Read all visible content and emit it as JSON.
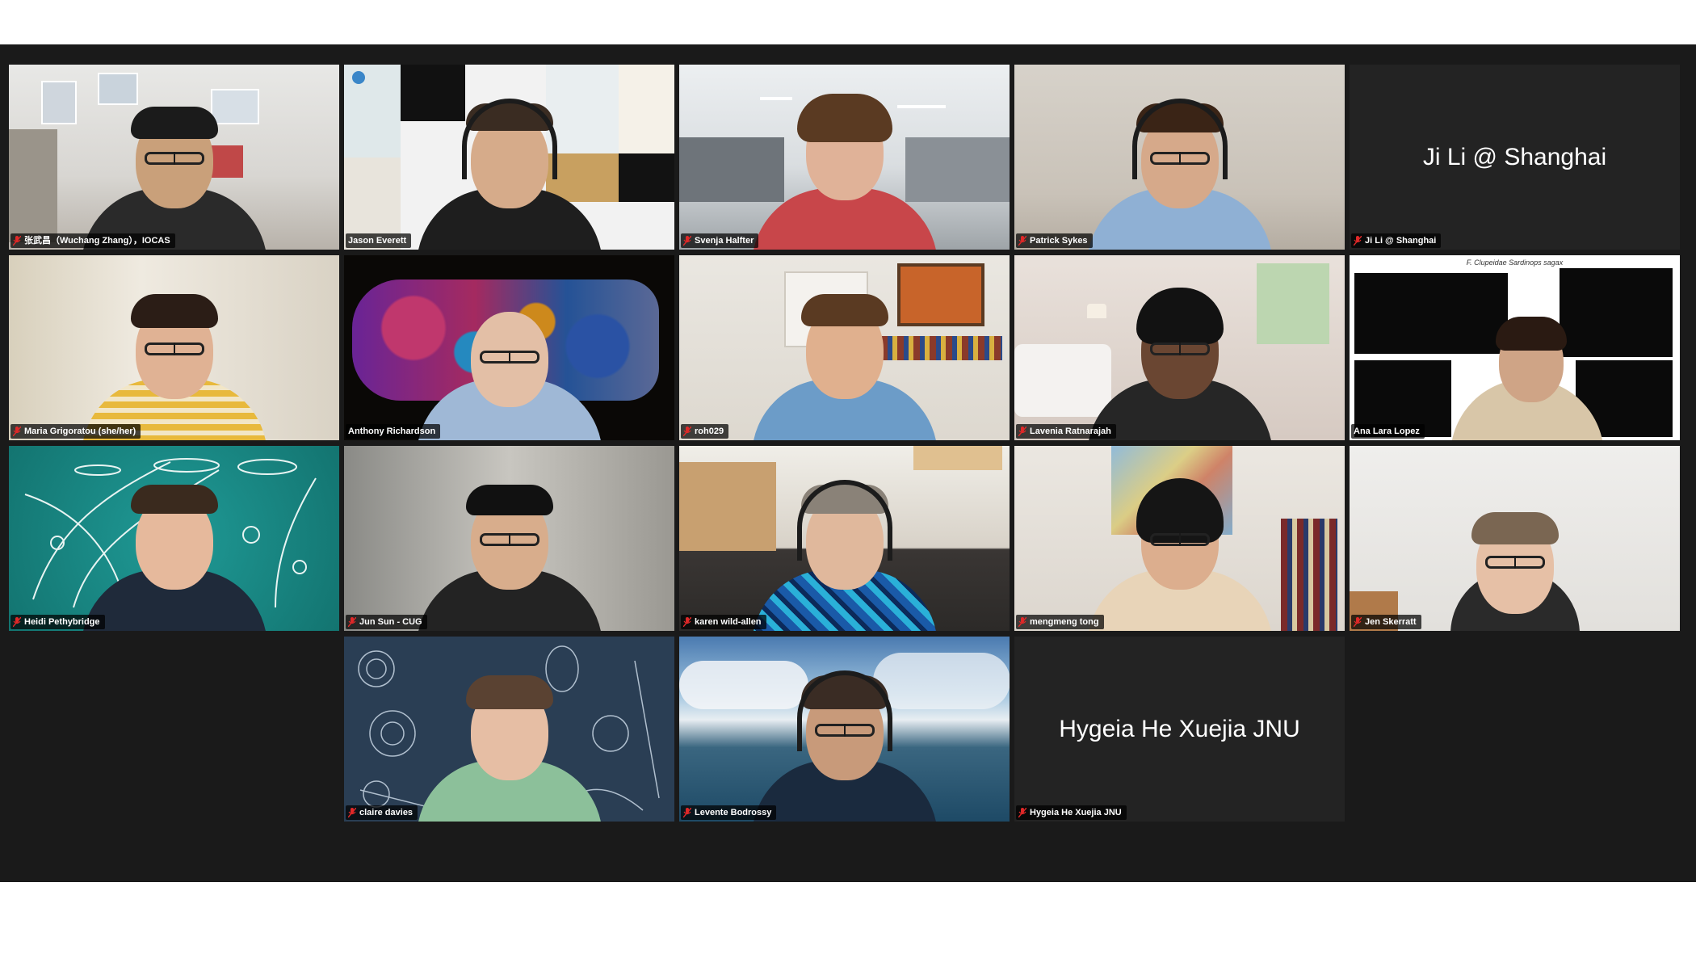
{
  "meeting": {
    "view": "gallery",
    "colors": {
      "background": "#1a1a1a",
      "tile_empty": "#232323",
      "active_speaker_border": "#c7e86a",
      "muted_icon": "#e02828",
      "name_text": "#ffffff"
    }
  },
  "participants": [
    {
      "name": "张武昌（Wuchang Zhang），IOCAS",
      "muted": true,
      "video": true
    },
    {
      "name": "Jason Everett",
      "muted": false,
      "video": true
    },
    {
      "name": "Svenja Halfter",
      "muted": true,
      "video": true
    },
    {
      "name": "Patrick Sykes",
      "muted": true,
      "video": true
    },
    {
      "name": "Ji Li @ Shanghai",
      "muted": true,
      "video": false,
      "display_name": "Ji Li @ Shanghai"
    },
    {
      "name": "Maria Grigoratou (she/her)",
      "muted": true,
      "video": true
    },
    {
      "name": "Anthony Richardson",
      "muted": false,
      "video": true
    },
    {
      "name": "roh029",
      "muted": true,
      "video": true
    },
    {
      "name": "Lavenia Ratnarajah",
      "muted": true,
      "video": true
    },
    {
      "name": "Ana Lara Lopez",
      "muted": false,
      "video": true,
      "active_speaker": true,
      "background_caption": "F. Clupeidae Sardinops sagax"
    },
    {
      "name": "Heidi Pethybridge",
      "muted": true,
      "video": true
    },
    {
      "name": "Jun Sun - CUG",
      "muted": true,
      "video": true
    },
    {
      "name": "karen wild-allen",
      "muted": true,
      "video": true
    },
    {
      "name": "mengmeng tong",
      "muted": true,
      "video": true
    },
    {
      "name": "Jen Skerratt",
      "muted": true,
      "video": true
    },
    {
      "name": "claire davies",
      "muted": true,
      "video": true
    },
    {
      "name": "Levente Bodrossy",
      "muted": true,
      "video": true
    },
    {
      "name": "Hygeia He Xuejia JNU",
      "muted": true,
      "video": false,
      "display_name": "Hygeia He Xuejia JNU"
    }
  ],
  "icons": {
    "muted": "mic-muted-icon"
  }
}
